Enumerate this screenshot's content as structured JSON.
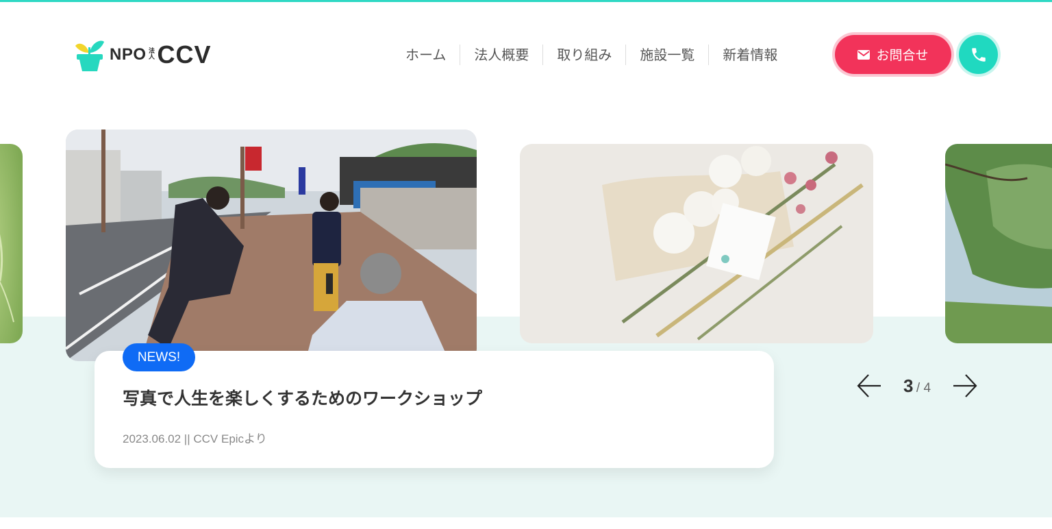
{
  "header": {
    "logo": {
      "npo": "NPO",
      "hojin": "法人",
      "name": "CCV"
    },
    "nav": [
      {
        "label": "ホーム"
      },
      {
        "label": "法人概要"
      },
      {
        "label": "取り組み"
      },
      {
        "label": "施設一覧"
      },
      {
        "label": "新着情報"
      }
    ],
    "contact_label": "お問合せ",
    "icons": {
      "contact": "mail-icon",
      "phone": "phone-icon"
    }
  },
  "colors": {
    "accent_teal": "#2fd8c4",
    "contact_red": "#f2335a",
    "badge_blue": "#0f6bf5",
    "band_bg": "#e9f6f4"
  },
  "news": {
    "badge": "NEWS!",
    "title": "写真で人生を楽しくするためのワークショップ",
    "meta": "2023.06.02 || CCV Epicより"
  },
  "pager": {
    "current": "3",
    "rest": "/ 4",
    "prev_icon": "arrow-left-icon",
    "next_icon": "arrow-right-icon"
  }
}
